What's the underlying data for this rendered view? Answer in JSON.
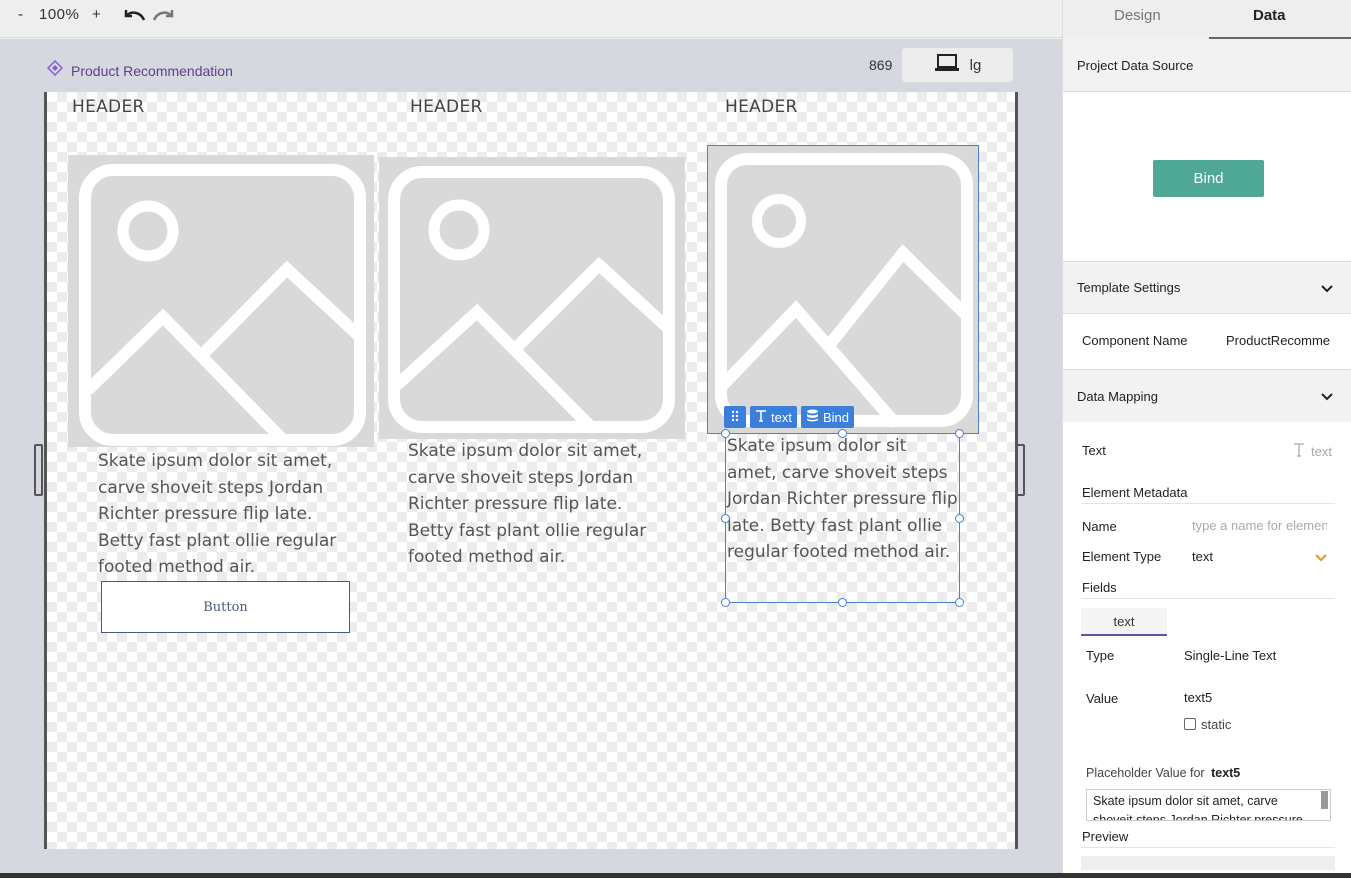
{
  "toolbar": {
    "zoom_minus": "-",
    "zoom_value": "100%",
    "zoom_plus": "+",
    "undo_icon": "undo-icon",
    "redo_icon": "redo-icon"
  },
  "canvas": {
    "breadcrumb": "Product Recommendation",
    "width_readout": "869",
    "device_label": "lg",
    "columns": [
      {
        "header": "HEADER",
        "text": "Skate ipsum dolor sit amet, carve shoveit steps Jordan Richter pressure flip late. Betty fast plant ollie regular footed method air."
      },
      {
        "header": "HEADER",
        "text": "Skate ipsum dolor sit amet, carve shoveit steps Jordan Richter pressure flip late. Betty fast plant ollie regular footed method air."
      },
      {
        "header": "HEADER",
        "text": "Skate ipsum dolor sit amet, carve shoveit steps Jordan Richter pressure flip late. Betty fast plant ollie regular footed method air."
      }
    ],
    "button_label": "Button",
    "selection_toolbar": {
      "text_label": "text",
      "bind_label": "Bind"
    }
  },
  "panel": {
    "tabs": {
      "design": "Design",
      "data": "Data"
    },
    "project_data_source": "Project Data Source",
    "bind_button": "Bind",
    "template_settings": "Template Settings",
    "component_name_label": "Component Name",
    "component_name_value": "ProductRecomme",
    "data_mapping": "Data Mapping",
    "text_label": "Text",
    "text_value": "text",
    "element_metadata": "Element Metadata",
    "name_label": "Name",
    "name_placeholder": "type a name for element",
    "element_type_label": "Element Type",
    "element_type_value": "text",
    "fields_label": "Fields",
    "field_tab": "text",
    "type_label": "Type",
    "type_value": "Single-Line Text",
    "value_label": "Value",
    "value_value": "text5",
    "static_label": "static",
    "placeholder_label": "Placeholder Value for",
    "placeholder_field": "text5",
    "placeholder_text": "Skate ipsum dolor sit amet, carve shoveit steps Jordan Richter pressure",
    "preview_label": "Preview"
  },
  "colors": {
    "accent": "#3b7fdb",
    "bind_green": "#4fa796",
    "brand_purple": "#6b4fa0"
  }
}
